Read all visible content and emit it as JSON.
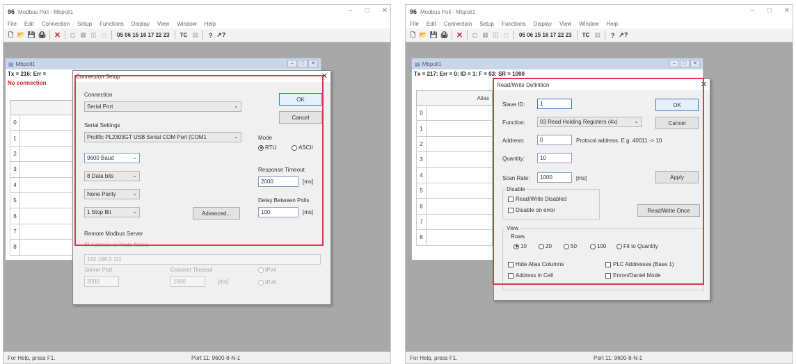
{
  "app": {
    "title": "Modbus Poll - Mbpoll1",
    "icon_text": "96",
    "menu": [
      "File",
      "Edit",
      "Connection",
      "Setup",
      "Functions",
      "Display",
      "View",
      "Window",
      "Help"
    ],
    "toolbar_codes": "05 06 15 16 17 22 23",
    "toolbar_tc": "TC",
    "status_help": "For Help, press F1.",
    "status_port": "Port 11: 9600-8-N-1",
    "mdi_title": "Mbpoll1",
    "row_indices": [
      "0",
      "1",
      "2",
      "3",
      "4",
      "5",
      "6",
      "7",
      "8"
    ]
  },
  "left": {
    "tx_line": "Tx = 216: Err =",
    "no_connection": "No connection",
    "dialog": {
      "title": "Connection Setup",
      "connection_label": "Connection",
      "connection_value": "Serial Port",
      "serial_settings_label": "Serial Settings",
      "port_value": "Prolific PL2303GT USB Serial COM Port (COM1",
      "baud_value": "9600 Baud",
      "data_bits_value": "8 Data bits",
      "parity_value": "None Parity",
      "stop_bits_value": "1 Stop Bit",
      "advanced_label": "Advanced...",
      "ok_label": "OK",
      "cancel_label": "Cancel",
      "mode_label": "Mode",
      "mode_rtu": "RTU",
      "mode_ascii": "ASCII",
      "response_timeout_label": "Response Timeout",
      "response_timeout_value": "2000",
      "delay_polls_label": "Delay Between Polls",
      "delay_polls_value": "100",
      "unit_ms": "[ms]",
      "remote_server_label": "Remote Modbus Server",
      "ip_label": "IP Address or Node Name",
      "ip_value": "192.168.0.111",
      "server_port_label": "Server Port",
      "server_port_value": "2000",
      "connect_timeout_label": "Connect Timeout",
      "connect_timeout_value": "1000",
      "ipv4_label": "IPv4",
      "ipv6_label": "IPv6"
    }
  },
  "right": {
    "tx_line": "Tx = 217: Err = 0: ID = 1: F = 03: SR = 1000",
    "col_alias": "Alias",
    "dialog": {
      "title": "Read/Write Definition",
      "slave_id_label": "Slave ID:",
      "slave_id_value": "1",
      "function_label": "Function:",
      "function_value": "03 Read Holding Registers (4x)",
      "address_label": "Address:",
      "address_value": "0",
      "protocol_address_note": "Protocol address. E.g. 40011 -> 10",
      "quantity_label": "Quantity:",
      "quantity_value": "10",
      "scan_rate_label": "Scan Rate:",
      "scan_rate_value": "1000",
      "unit_ms": "[ms]",
      "apply_label": "Apply",
      "ok_label": "OK",
      "cancel_label": "Cancel",
      "disable_label": "Disable",
      "rw_disabled_label": "Read/Write Disabled",
      "disable_on_error_label": "Disable on error",
      "rw_once_label": "Read/Write Once",
      "view_label": "View",
      "rows_label": "Rows",
      "rows_options": [
        "10",
        "20",
        "50",
        "100",
        "Fit to Quantity"
      ],
      "hide_alias_label": "Hide Alias Columns",
      "plc_addresses_label": "PLC Addresses (Base 1)",
      "address_in_cell_label": "Address in Cell",
      "enron_label": "Enron/Daniel Mode"
    }
  },
  "colors": {
    "highlight_box": "#d83a4a",
    "no_connection": "#d01818",
    "workspace": "#a8a8a8"
  }
}
